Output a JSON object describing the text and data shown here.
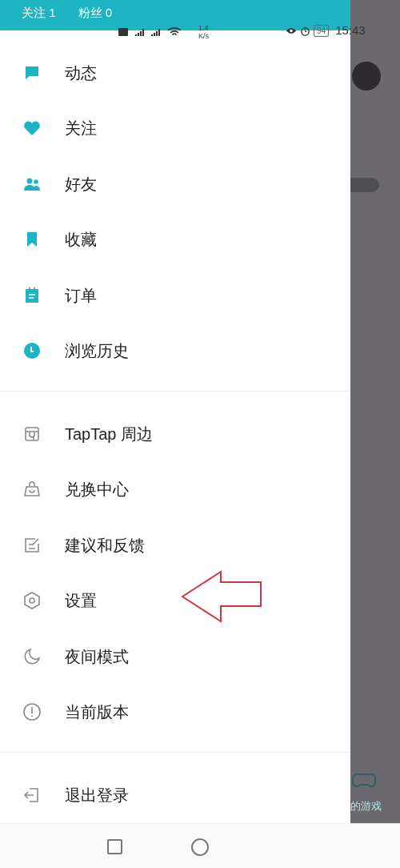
{
  "header": {
    "following": "关注 1",
    "followers": "粉丝 0"
  },
  "status_bar": {
    "speed_value": "1.4",
    "speed_unit": "K/s",
    "battery": "94",
    "time": "15:43"
  },
  "menu_groups": [
    [
      {
        "label": "动态"
      },
      {
        "label": "关注"
      },
      {
        "label": "好友"
      },
      {
        "label": "收藏"
      },
      {
        "label": "订单"
      },
      {
        "label": "浏览历史"
      }
    ],
    [
      {
        "label": "TapTap 周边"
      },
      {
        "label": "兑换中心"
      },
      {
        "label": "建议和反馈"
      },
      {
        "label": "设置"
      },
      {
        "label": "夜间模式"
      },
      {
        "label": "当前版本"
      }
    ],
    [
      {
        "label": "退出登录"
      }
    ]
  ],
  "background": {
    "tab_label": "的游戏"
  }
}
